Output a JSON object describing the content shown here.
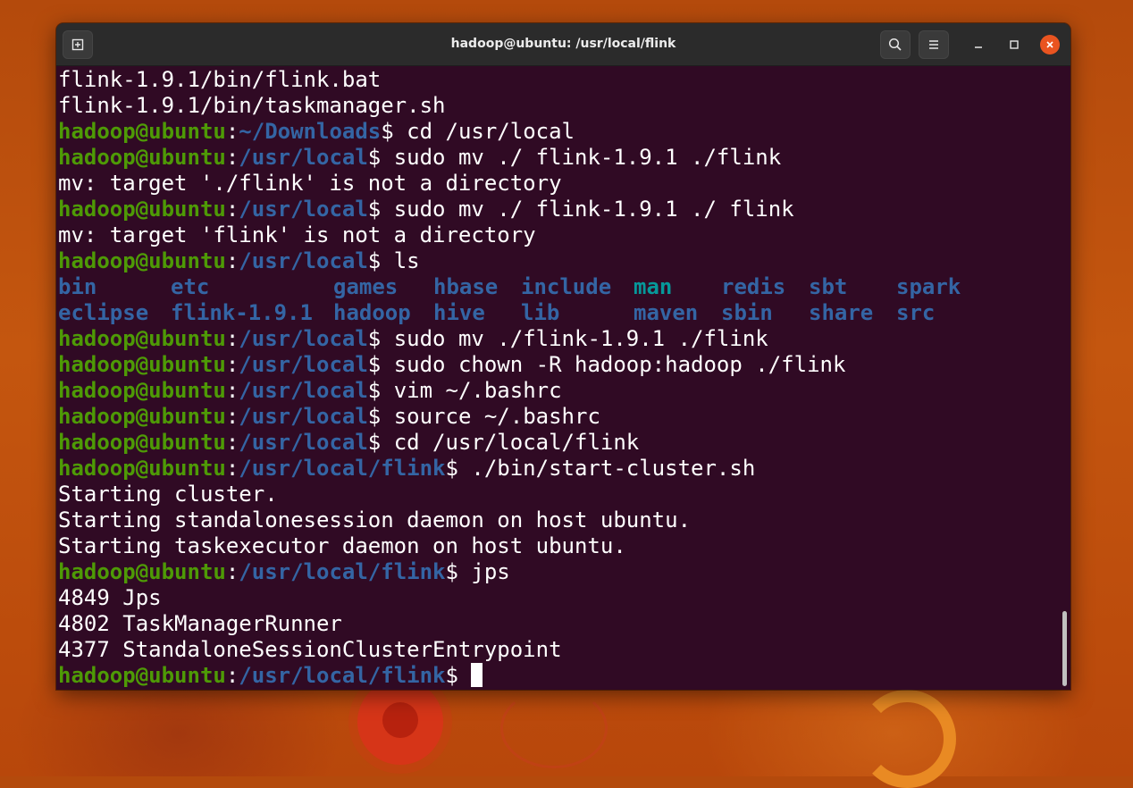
{
  "window": {
    "title": "hadoop@ubuntu: /usr/local/flink",
    "close_color": "#e95420"
  },
  "icons": {
    "new_tab": "new-tab-icon",
    "search": "search-icon",
    "menu": "hamburger-menu-icon",
    "minimize": "minimize-icon",
    "maximize": "maximize-icon",
    "close": "close-icon"
  },
  "colors": {
    "background": "#300a24",
    "user_host": "#4e9a06",
    "path": "#3465a4",
    "teal": "#06989a",
    "text": "#ffffff"
  },
  "terminal": {
    "user": "hadoop@ubuntu",
    "lines": [
      {
        "type": "output",
        "text": "flink-1.9.1/bin/flink.bat"
      },
      {
        "type": "output",
        "text": "flink-1.9.1/bin/taskmanager.sh"
      },
      {
        "type": "prompt",
        "path": "~/Downloads",
        "cmd": " cd /usr/local"
      },
      {
        "type": "prompt",
        "path": "/usr/local",
        "cmd": " sudo mv ./ flink-1.9.1 ./flink"
      },
      {
        "type": "output",
        "text": "mv: target './flink' is not a directory"
      },
      {
        "type": "prompt",
        "path": "/usr/local",
        "cmd": " sudo mv ./ flink-1.9.1 ./ flink"
      },
      {
        "type": "output",
        "text": "mv: target 'flink' is not a directory"
      },
      {
        "type": "prompt",
        "path": "/usr/local",
        "cmd": " ls"
      },
      {
        "type": "ls",
        "items": [
          {
            "name": "bin",
            "w": 9
          },
          {
            "name": "etc",
            "w": 13
          },
          {
            "name": "games",
            "w": 8
          },
          {
            "name": "hbase",
            "w": 7
          },
          {
            "name": "include",
            "w": 9
          },
          {
            "name": "man",
            "w": 7,
            "teal": true
          },
          {
            "name": "redis",
            "w": 7
          },
          {
            "name": "sbt",
            "w": 7
          },
          {
            "name": "spark",
            "w": 0
          }
        ]
      },
      {
        "type": "ls",
        "items": [
          {
            "name": "eclipse",
            "w": 9
          },
          {
            "name": "flink-1.9.1",
            "w": 13
          },
          {
            "name": "hadoop",
            "w": 8
          },
          {
            "name": "hive",
            "w": 7
          },
          {
            "name": "lib",
            "w": 9
          },
          {
            "name": "maven",
            "w": 7
          },
          {
            "name": "sbin",
            "w": 7
          },
          {
            "name": "share",
            "w": 7
          },
          {
            "name": "src",
            "w": 0
          }
        ]
      },
      {
        "type": "prompt",
        "path": "/usr/local",
        "cmd": " sudo mv ./flink-1.9.1 ./flink"
      },
      {
        "type": "prompt",
        "path": "/usr/local",
        "cmd": " sudo chown -R hadoop:hadoop ./flink"
      },
      {
        "type": "prompt",
        "path": "/usr/local",
        "cmd": " vim ~/.bashrc"
      },
      {
        "type": "prompt",
        "path": "/usr/local",
        "cmd": " source ~/.bashrc"
      },
      {
        "type": "prompt",
        "path": "/usr/local",
        "cmd": " cd /usr/local/flink"
      },
      {
        "type": "prompt",
        "path": "/usr/local/flink",
        "cmd": " ./bin/start-cluster.sh"
      },
      {
        "type": "output",
        "text": "Starting cluster."
      },
      {
        "type": "output",
        "text": "Starting standalonesession daemon on host ubuntu."
      },
      {
        "type": "output",
        "text": "Starting taskexecutor daemon on host ubuntu."
      },
      {
        "type": "prompt",
        "path": "/usr/local/flink",
        "cmd": " jps"
      },
      {
        "type": "output",
        "text": "4849 Jps"
      },
      {
        "type": "output",
        "text": "4802 TaskManagerRunner"
      },
      {
        "type": "output",
        "text": "4377 StandaloneSessionClusterEntrypoint"
      },
      {
        "type": "prompt",
        "path": "/usr/local/flink",
        "cmd": " ",
        "cursor": true
      }
    ]
  }
}
